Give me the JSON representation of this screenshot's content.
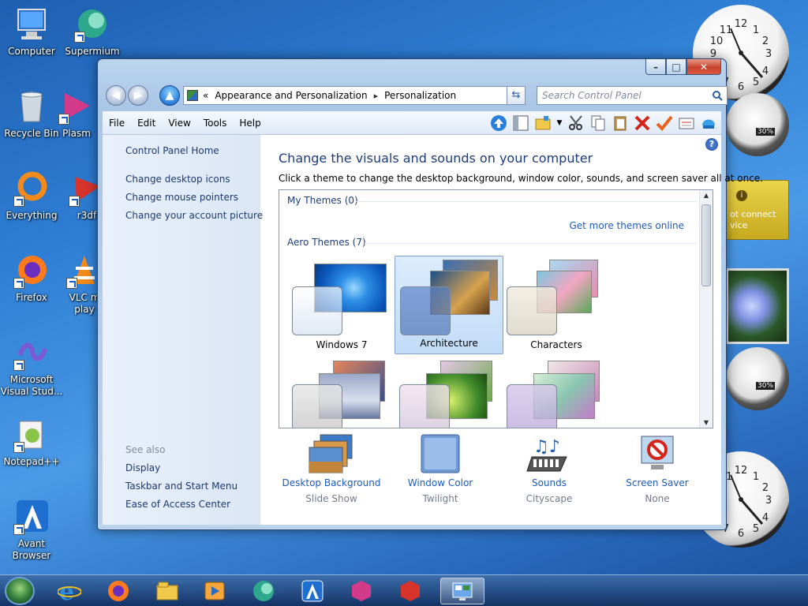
{
  "desktop": {
    "icons": [
      {
        "label": "Computer",
        "icon": "computer-icon"
      },
      {
        "label": "Supermium",
        "icon": "supermium-icon"
      },
      {
        "label": "Recycle Bin",
        "icon": "recycle-bin-icon"
      },
      {
        "label": "Plasm",
        "icon": "plasma-icon"
      },
      {
        "label": "Everything",
        "icon": "everything-icon"
      },
      {
        "label": "r3df",
        "icon": "r3dfox-icon"
      },
      {
        "label": "Firefox",
        "icon": "firefox-icon"
      },
      {
        "label": "VLC m",
        "label2": "play",
        "icon": "vlc-icon"
      },
      {
        "label": "Microsoft",
        "label2": "Visual Stud...",
        "icon": "visual-studio-icon"
      },
      {
        "label": "Notepad++",
        "icon": "notepadpp-icon"
      },
      {
        "label": "Avant",
        "label2": "Browser",
        "icon": "avant-browser-icon"
      }
    ],
    "gadgets": {
      "meter_percent": "30%",
      "news_text_1": "ot connect",
      "news_text_2": "vice"
    }
  },
  "window": {
    "caption": {
      "minimize": "–",
      "maximize": "□",
      "close": "✕"
    },
    "address": {
      "prefix": "«",
      "crumbs": [
        "Appearance and Personalization",
        "Personalization"
      ],
      "sep": "▸"
    },
    "search": {
      "placeholder": "Search Control Panel"
    },
    "menu": [
      "File",
      "Edit",
      "View",
      "Tools",
      "Help"
    ],
    "left_pane": {
      "home": "Control Panel Home",
      "links": [
        "Change desktop icons",
        "Change mouse pointers",
        "Change your account picture"
      ],
      "see_also_title": "See also",
      "see_also": [
        "Display",
        "Taskbar and Start Menu",
        "Ease of Access Center"
      ]
    },
    "main": {
      "title": "Change the visuals and sounds on your computer",
      "subtitle": "Click a theme to change the desktop background, window color, sounds, and screen saver all at once.",
      "my_themes": "My Themes (0)",
      "get_more": "Get more themes online",
      "aero_themes": "Aero Themes (7)",
      "themes": [
        "Windows 7",
        "Architecture",
        "Characters",
        "",
        "",
        ""
      ],
      "selected_theme": "Architecture"
    },
    "bottom": [
      {
        "label": "Desktop Background",
        "value": "Slide Show",
        "icon": "desktop-background-icon"
      },
      {
        "label": "Window Color",
        "value": "Twilight",
        "icon": "window-color-icon"
      },
      {
        "label": "Sounds",
        "value": "Cityscape",
        "icon": "sounds-icon"
      },
      {
        "label": "Screen Saver",
        "value": "None",
        "icon": "screen-saver-icon"
      }
    ]
  },
  "taskbar": {
    "items": [
      "start-orb",
      "internet-explorer",
      "firefox",
      "file-explorer",
      "media-player",
      "supermium",
      "avant-browser",
      "plasma",
      "r3dfox",
      "personalization"
    ]
  }
}
